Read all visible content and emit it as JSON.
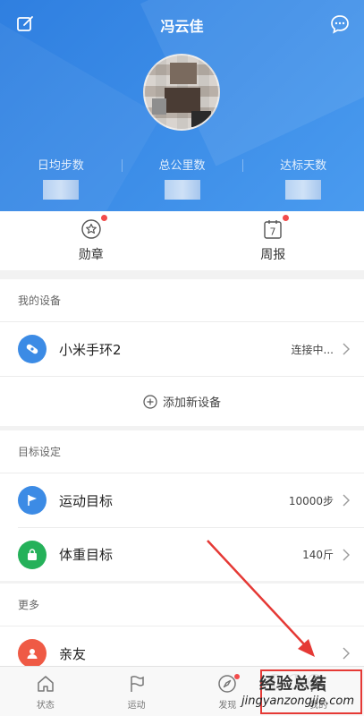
{
  "header": {
    "title": "冯云佳",
    "stats": [
      {
        "label": "日均步数"
      },
      {
        "label": "总公里数"
      },
      {
        "label": "达标天数"
      }
    ]
  },
  "quick": {
    "medal": "勋章",
    "weekly": "周报",
    "weekly_day": "7"
  },
  "devices": {
    "title": "我的设备",
    "items": [
      {
        "label": "小米手环2",
        "status": "连接中..."
      }
    ],
    "add_label": "添加新设备"
  },
  "goals": {
    "title": "目标设定",
    "items": [
      {
        "label": "运动目标",
        "value": "10000步"
      },
      {
        "label": "体重目标",
        "value": "140斤"
      }
    ]
  },
  "more": {
    "title": "更多",
    "items": [
      {
        "label": "亲友"
      }
    ]
  },
  "tabs": [
    {
      "label": "状态"
    },
    {
      "label": "运动"
    },
    {
      "label": "发现"
    },
    {
      "label": "我的"
    }
  ],
  "watermark": {
    "brand": "经验总结",
    "url": "jingyanzongjie.com"
  },
  "colors": {
    "header_blue": "#3d8ee8",
    "device_icon": "#3c8be5",
    "sport_icon": "#3c8be5",
    "weight_icon": "#25b15a",
    "friend_icon": "#ef5a45",
    "badge_red": "#f24b4b",
    "annotation_red": "#e53935"
  }
}
